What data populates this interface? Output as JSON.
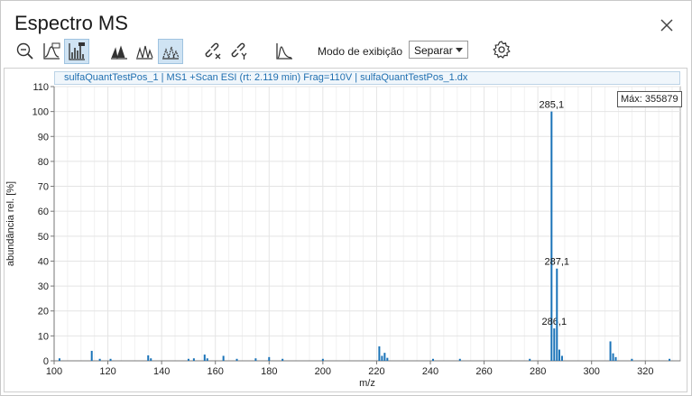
{
  "window": {
    "title": "Espectro MS"
  },
  "toolbar": {
    "buttons": [
      {
        "icon": "zoom-out-icon",
        "active": false
      },
      {
        "icon": "autoscale-icon",
        "active": false
      },
      {
        "icon": "bar-spectrum-icon",
        "active": true
      },
      {
        "icon": "overlay-peaks-icon",
        "active": false
      },
      {
        "icon": "stack-peaks-icon",
        "active": false
      },
      {
        "icon": "separate-peaks-icon",
        "active": true
      },
      {
        "icon": "unlink-x-icon",
        "active": false
      },
      {
        "icon": "unlink-y-icon",
        "active": false
      },
      {
        "icon": "peak-shape-icon",
        "active": false
      }
    ],
    "mode_label": "Modo de exibição",
    "mode_value": "Separar"
  },
  "plot": {
    "header": "sulfaQuantTestPos_1 | MS1 +Scan ESI (rt: 2.119 min) Frag=110V | sulfaQuantTestPos_1.dx",
    "max_label": "Máx: 355879"
  },
  "chart_data": {
    "type": "bar",
    "xlabel": "m/z",
    "ylabel": "abundância rel. [%]",
    "xlim": [
      100,
      333
    ],
    "ylim": [
      0,
      110
    ],
    "xticks": [
      100,
      120,
      140,
      160,
      180,
      200,
      220,
      240,
      260,
      280,
      300,
      320
    ],
    "yticks": [
      0,
      10,
      20,
      30,
      40,
      50,
      60,
      70,
      80,
      90,
      100,
      110
    ],
    "grid": true,
    "series": [
      {
        "color": "#1a73b8",
        "peaks": [
          {
            "x": 102.0,
            "y": 1.0
          },
          {
            "x": 114.0,
            "y": 4.0
          },
          {
            "x": 117.0,
            "y": 0.8
          },
          {
            "x": 121.0,
            "y": 0.8
          },
          {
            "x": 135.0,
            "y": 2.2
          },
          {
            "x": 136.0,
            "y": 1.0
          },
          {
            "x": 150.0,
            "y": 0.8
          },
          {
            "x": 152.0,
            "y": 1.0
          },
          {
            "x": 156.0,
            "y": 2.5
          },
          {
            "x": 157.0,
            "y": 1.0
          },
          {
            "x": 163.0,
            "y": 2.0
          },
          {
            "x": 168.0,
            "y": 0.8
          },
          {
            "x": 175.0,
            "y": 1.0
          },
          {
            "x": 180.0,
            "y": 1.5
          },
          {
            "x": 185.0,
            "y": 0.8
          },
          {
            "x": 200.0,
            "y": 0.8
          },
          {
            "x": 221.0,
            "y": 5.8
          },
          {
            "x": 222.0,
            "y": 2.0
          },
          {
            "x": 223.0,
            "y": 3.2
          },
          {
            "x": 224.0,
            "y": 1.2
          },
          {
            "x": 241.0,
            "y": 0.8
          },
          {
            "x": 251.0,
            "y": 0.8
          },
          {
            "x": 277.0,
            "y": 0.8
          },
          {
            "x": 285.1,
            "y": 100.0,
            "label": "285,1"
          },
          {
            "x": 286.1,
            "y": 13.0,
            "label": "286,1"
          },
          {
            "x": 287.1,
            "y": 37.0,
            "label": "287,1"
          },
          {
            "x": 288.0,
            "y": 4.5
          },
          {
            "x": 289.0,
            "y": 2.0
          },
          {
            "x": 307.0,
            "y": 7.8
          },
          {
            "x": 308.0,
            "y": 3.0
          },
          {
            "x": 309.0,
            "y": 1.5
          },
          {
            "x": 315.0,
            "y": 0.8
          },
          {
            "x": 329.0,
            "y": 0.8
          }
        ]
      }
    ]
  }
}
